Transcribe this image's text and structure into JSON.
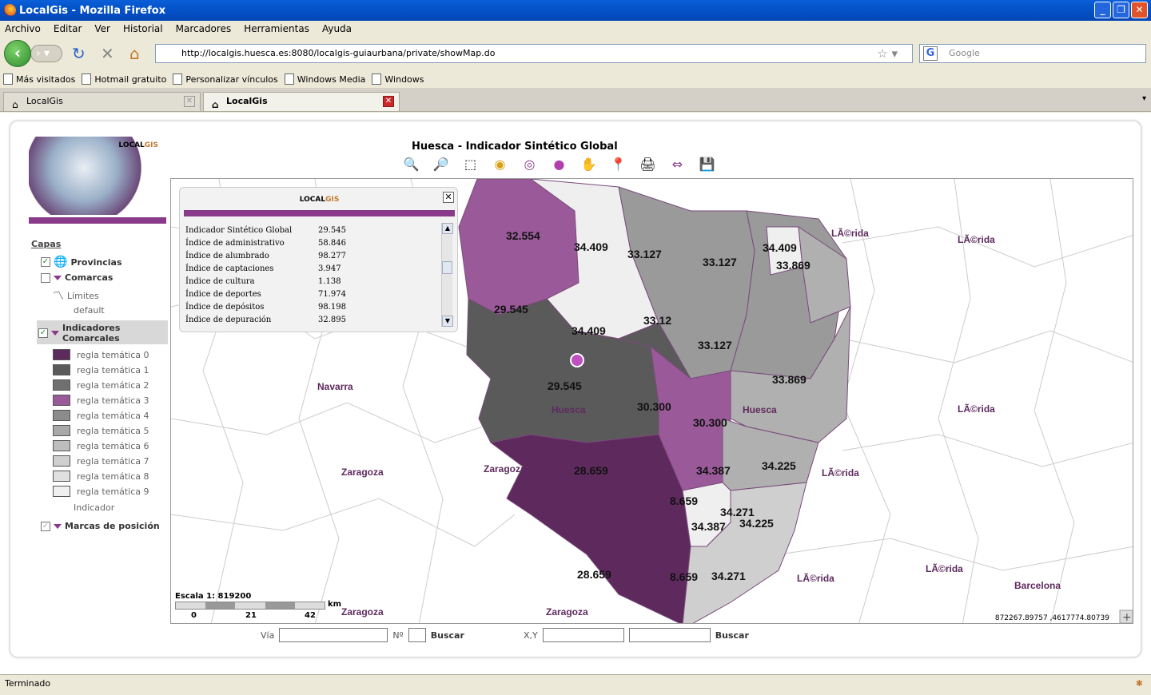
{
  "window": {
    "title": "LocalGis - Mozilla Firefox"
  },
  "menu": [
    "Archivo",
    "Editar",
    "Ver",
    "Historial",
    "Marcadores",
    "Herramientas",
    "Ayuda"
  ],
  "address": {
    "url": "http://localgis.huesca.es:8080/localgis-guiaurbana/private/showMap.do",
    "search_placeholder": "Google"
  },
  "bookmarks": [
    "Más visitados",
    "Hotmail gratuito",
    "Personalizar vínculos",
    "Windows Media",
    "Windows"
  ],
  "tabs": [
    {
      "label": "LocalGis",
      "active": false
    },
    {
      "label": "LocalGis",
      "active": true
    }
  ],
  "logo": {
    "text_a": "LOCAL",
    "text_b": "GIS"
  },
  "sidebar": {
    "capas": "Capas",
    "provincias": "Provincias",
    "comarcas": "Comarcas",
    "limites": "Límites",
    "default": "default",
    "indicadores": "Indicadores Comarcales",
    "reglas": [
      {
        "label": "regla temática 0",
        "color": "#5e2a5e"
      },
      {
        "label": "regla temática 1",
        "color": "#5a5a5a"
      },
      {
        "label": "regla temática 2",
        "color": "#707070"
      },
      {
        "label": "regla temática 3",
        "color": "#9a5a9a"
      },
      {
        "label": "regla temática 4",
        "color": "#8c8c8c"
      },
      {
        "label": "regla temática 5",
        "color": "#a8a8a8"
      },
      {
        "label": "regla temática 6",
        "color": "#bdbdbd"
      },
      {
        "label": "regla temática 7",
        "color": "#cfcfcf"
      },
      {
        "label": "regla temática 8",
        "color": "#e0e0e0"
      },
      {
        "label": "regla temática 9",
        "color": "#f0f0f0"
      }
    ],
    "indicador": "Indicador",
    "marcas": "Marcas de posición"
  },
  "map": {
    "title": "Huesca - Indicador Sintético Global",
    "scale": "Escala 1: 819200",
    "scale_ticks": [
      "0",
      "21",
      "42"
    ],
    "scale_unit": "km",
    "coords": "872267.89757 ,4617774.80739",
    "region_labels": [
      {
        "text": "32.554"
      },
      {
        "text": "34.409"
      },
      {
        "text": "33.127"
      },
      {
        "text": "33.127"
      },
      {
        "text": "34.409"
      },
      {
        "text": "33.869"
      },
      {
        "text": "29.545"
      },
      {
        "text": "34.409"
      },
      {
        "text": "33.12"
      },
      {
        "text": "33.127"
      },
      {
        "text": "33.869"
      },
      {
        "text": "29.545"
      },
      {
        "text": "30.300"
      },
      {
        "text": "30.300"
      },
      {
        "text": "28.659"
      },
      {
        "text": "34.387"
      },
      {
        "text": "34.225"
      },
      {
        "text": "8.659"
      },
      {
        "text": "34.271"
      },
      {
        "text": "34.387"
      },
      {
        "text": "34.225"
      },
      {
        "text": "28.659"
      },
      {
        "text": "8.659"
      },
      {
        "text": "34.271"
      }
    ],
    "place_labels": [
      {
        "text": "LÃ©rida"
      },
      {
        "text": "LÃ©rida"
      },
      {
        "text": "Navarra"
      },
      {
        "text": "Huesca"
      },
      {
        "text": "Huesca"
      },
      {
        "text": "LÃ©rida"
      },
      {
        "text": "Zaragoza"
      },
      {
        "text": "Zaragoza"
      },
      {
        "text": "LÃ©rida"
      },
      {
        "text": "LÃ©rida"
      },
      {
        "text": "LÃ©rida"
      },
      {
        "text": "Barcelona"
      },
      {
        "text": "Zaragoza"
      },
      {
        "text": "Zaragoza"
      }
    ]
  },
  "info": {
    "title_a": "LOCAL",
    "title_b": "GIS",
    "rows": [
      {
        "k": "Indicador Sintético Global",
        "v": "29.545"
      },
      {
        "k": "Índice de administrativo",
        "v": "58.846"
      },
      {
        "k": "Índice de alumbrado",
        "v": "98.277"
      },
      {
        "k": "Índice de captaciones",
        "v": "3.947"
      },
      {
        "k": "Índice de cultura",
        "v": "1.138"
      },
      {
        "k": "Índice de deportes",
        "v": "71.974"
      },
      {
        "k": "Índice de depósitos",
        "v": "98.198"
      },
      {
        "k": "Índice de depuración",
        "v": "32.895"
      }
    ]
  },
  "search": {
    "via": "Vía",
    "num": "Nº",
    "buscar1": "Buscar",
    "xy": "X,Y",
    "buscar2": "Buscar"
  },
  "status": "Terminado"
}
